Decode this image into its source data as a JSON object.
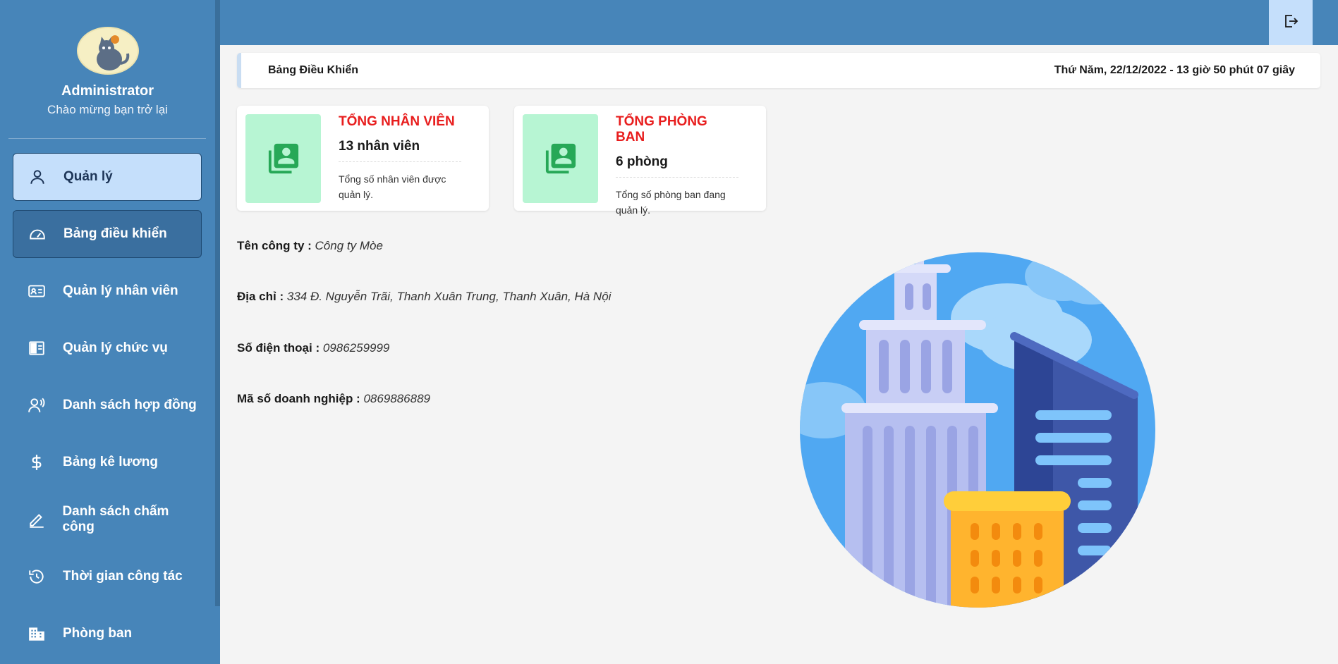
{
  "profile": {
    "name": "Administrator",
    "subtitle": "Chào mừng bạn trở lại"
  },
  "sidebar": {
    "items": [
      {
        "label": "Quản lý",
        "icon": "user-icon",
        "state": "active"
      },
      {
        "label": "Bảng điều khiển",
        "icon": "dashboard-icon",
        "state": "selected"
      },
      {
        "label": "Quản lý nhân viên",
        "icon": "id-card-icon",
        "state": ""
      },
      {
        "label": "Quản lý chức vụ",
        "icon": "layout-icon",
        "state": ""
      },
      {
        "label": "Danh sách hợp đồng",
        "icon": "user-voice-icon",
        "state": ""
      },
      {
        "label": "Bảng kê lương",
        "icon": "dollar-icon",
        "state": ""
      },
      {
        "label": "Danh sách chấm công",
        "icon": "pencil-icon",
        "state": ""
      },
      {
        "label": "Thời gian công tác",
        "icon": "history-icon",
        "state": ""
      },
      {
        "label": "Phòng ban",
        "icon": "building-icon",
        "state": ""
      }
    ]
  },
  "header": {
    "logout_icon": "logout-icon"
  },
  "breadcrumb": {
    "title": "Bảng Điều Khiển",
    "datetime": "Thứ Năm, 22/12/2022 - 13 giờ 50 phút 07 giây"
  },
  "cards": [
    {
      "title": "TỔNG NHÂN VIÊN",
      "value": "13 nhân viên",
      "desc": "Tổng số nhân viên được quản lý.",
      "icon": "contacts-icon"
    },
    {
      "title": "TỔNG PHÒNG BAN",
      "value": "6 phòng",
      "desc": "Tổng số phòng ban đang quản lý.",
      "icon": "contacts-icon"
    }
  ],
  "company": {
    "name_label": "Tên công ty :",
    "name": "Công ty Mòe",
    "address_label": "Địa chỉ :",
    "address": "334 Đ. Nguyễn Trãi, Thanh Xuân Trung, Thanh Xuân, Hà Nội",
    "phone_label": "Số điện thoại :",
    "phone": "0986259999",
    "tax_label": "Mã số doanh nghiệp :",
    "tax": "0869886889"
  },
  "colors": {
    "primary": "#4785b9",
    "active_bg": "#c5dffb",
    "accent_red": "#e81d1d",
    "card_icon_bg": "#b7f5d3",
    "card_icon_fg": "#27a857"
  }
}
